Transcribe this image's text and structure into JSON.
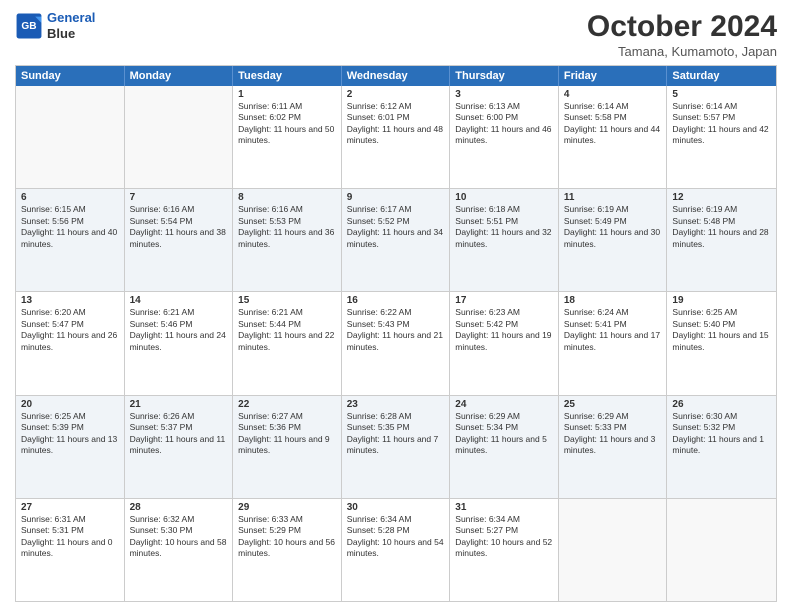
{
  "header": {
    "logo_line1": "General",
    "logo_line2": "Blue",
    "month": "October 2024",
    "location": "Tamana, Kumamoto, Japan"
  },
  "days": [
    "Sunday",
    "Monday",
    "Tuesday",
    "Wednesday",
    "Thursday",
    "Friday",
    "Saturday"
  ],
  "rows": [
    [
      {
        "num": "",
        "text": "",
        "empty": true
      },
      {
        "num": "",
        "text": "",
        "empty": true
      },
      {
        "num": "1",
        "text": "Sunrise: 6:11 AM\nSunset: 6:02 PM\nDaylight: 11 hours and 50 minutes."
      },
      {
        "num": "2",
        "text": "Sunrise: 6:12 AM\nSunset: 6:01 PM\nDaylight: 11 hours and 48 minutes."
      },
      {
        "num": "3",
        "text": "Sunrise: 6:13 AM\nSunset: 6:00 PM\nDaylight: 11 hours and 46 minutes."
      },
      {
        "num": "4",
        "text": "Sunrise: 6:14 AM\nSunset: 5:58 PM\nDaylight: 11 hours and 44 minutes."
      },
      {
        "num": "5",
        "text": "Sunrise: 6:14 AM\nSunset: 5:57 PM\nDaylight: 11 hours and 42 minutes."
      }
    ],
    [
      {
        "num": "6",
        "text": "Sunrise: 6:15 AM\nSunset: 5:56 PM\nDaylight: 11 hours and 40 minutes."
      },
      {
        "num": "7",
        "text": "Sunrise: 6:16 AM\nSunset: 5:54 PM\nDaylight: 11 hours and 38 minutes."
      },
      {
        "num": "8",
        "text": "Sunrise: 6:16 AM\nSunset: 5:53 PM\nDaylight: 11 hours and 36 minutes."
      },
      {
        "num": "9",
        "text": "Sunrise: 6:17 AM\nSunset: 5:52 PM\nDaylight: 11 hours and 34 minutes."
      },
      {
        "num": "10",
        "text": "Sunrise: 6:18 AM\nSunset: 5:51 PM\nDaylight: 11 hours and 32 minutes."
      },
      {
        "num": "11",
        "text": "Sunrise: 6:19 AM\nSunset: 5:49 PM\nDaylight: 11 hours and 30 minutes."
      },
      {
        "num": "12",
        "text": "Sunrise: 6:19 AM\nSunset: 5:48 PM\nDaylight: 11 hours and 28 minutes."
      }
    ],
    [
      {
        "num": "13",
        "text": "Sunrise: 6:20 AM\nSunset: 5:47 PM\nDaylight: 11 hours and 26 minutes."
      },
      {
        "num": "14",
        "text": "Sunrise: 6:21 AM\nSunset: 5:46 PM\nDaylight: 11 hours and 24 minutes."
      },
      {
        "num": "15",
        "text": "Sunrise: 6:21 AM\nSunset: 5:44 PM\nDaylight: 11 hours and 22 minutes."
      },
      {
        "num": "16",
        "text": "Sunrise: 6:22 AM\nSunset: 5:43 PM\nDaylight: 11 hours and 21 minutes."
      },
      {
        "num": "17",
        "text": "Sunrise: 6:23 AM\nSunset: 5:42 PM\nDaylight: 11 hours and 19 minutes."
      },
      {
        "num": "18",
        "text": "Sunrise: 6:24 AM\nSunset: 5:41 PM\nDaylight: 11 hours and 17 minutes."
      },
      {
        "num": "19",
        "text": "Sunrise: 6:25 AM\nSunset: 5:40 PM\nDaylight: 11 hours and 15 minutes."
      }
    ],
    [
      {
        "num": "20",
        "text": "Sunrise: 6:25 AM\nSunset: 5:39 PM\nDaylight: 11 hours and 13 minutes."
      },
      {
        "num": "21",
        "text": "Sunrise: 6:26 AM\nSunset: 5:37 PM\nDaylight: 11 hours and 11 minutes."
      },
      {
        "num": "22",
        "text": "Sunrise: 6:27 AM\nSunset: 5:36 PM\nDaylight: 11 hours and 9 minutes."
      },
      {
        "num": "23",
        "text": "Sunrise: 6:28 AM\nSunset: 5:35 PM\nDaylight: 11 hours and 7 minutes."
      },
      {
        "num": "24",
        "text": "Sunrise: 6:29 AM\nSunset: 5:34 PM\nDaylight: 11 hours and 5 minutes."
      },
      {
        "num": "25",
        "text": "Sunrise: 6:29 AM\nSunset: 5:33 PM\nDaylight: 11 hours and 3 minutes."
      },
      {
        "num": "26",
        "text": "Sunrise: 6:30 AM\nSunset: 5:32 PM\nDaylight: 11 hours and 1 minute."
      }
    ],
    [
      {
        "num": "27",
        "text": "Sunrise: 6:31 AM\nSunset: 5:31 PM\nDaylight: 11 hours and 0 minutes."
      },
      {
        "num": "28",
        "text": "Sunrise: 6:32 AM\nSunset: 5:30 PM\nDaylight: 10 hours and 58 minutes."
      },
      {
        "num": "29",
        "text": "Sunrise: 6:33 AM\nSunset: 5:29 PM\nDaylight: 10 hours and 56 minutes."
      },
      {
        "num": "30",
        "text": "Sunrise: 6:34 AM\nSunset: 5:28 PM\nDaylight: 10 hours and 54 minutes."
      },
      {
        "num": "31",
        "text": "Sunrise: 6:34 AM\nSunset: 5:27 PM\nDaylight: 10 hours and 52 minutes."
      },
      {
        "num": "",
        "text": "",
        "empty": true
      },
      {
        "num": "",
        "text": "",
        "empty": true
      }
    ]
  ]
}
